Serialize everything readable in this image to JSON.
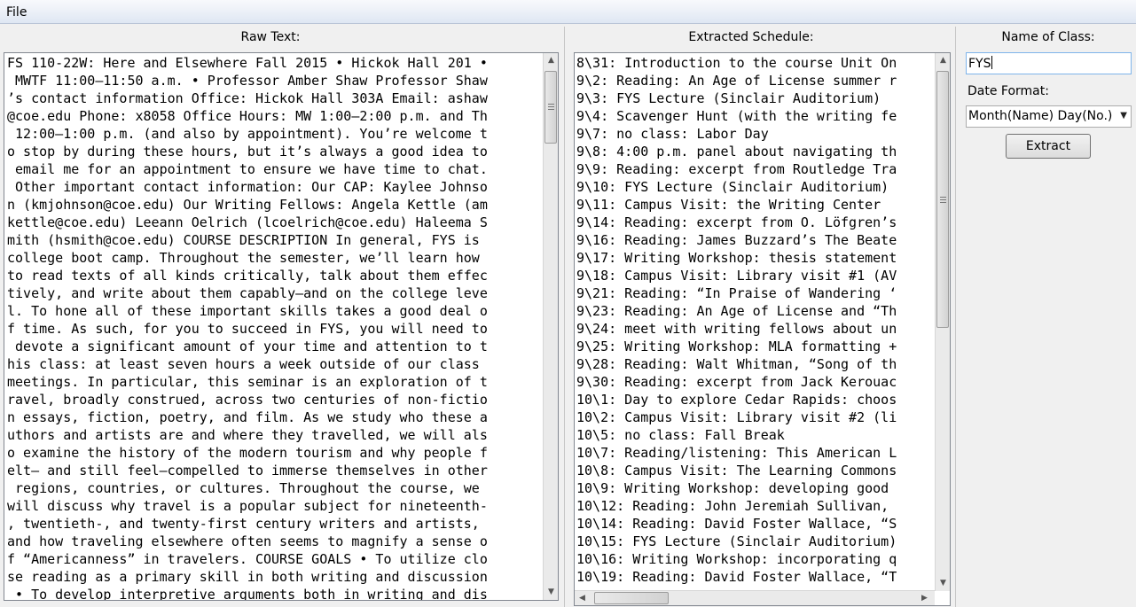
{
  "menu": {
    "file": "File"
  },
  "raw_panel": {
    "title": "Raw Text:",
    "lines": [
      "FS 110-22W: Here and Elsewhere Fall 2015 • Hickok Hall 201 •",
      " MWTF 11:00–11:50 a.m. • Professor Amber Shaw Professor Shaw",
      "’s contact information Office: Hickok Hall 303A Email: ashaw",
      "@coe.edu Phone: x8058 Office Hours: MW 1:00–2:00 p.m. and Th",
      " 12:00–1:00 p.m. (and also by appointment). You’re welcome t",
      "o stop by during these hours, but it’s always a good idea to",
      " email me for an appointment to ensure we have time to chat.",
      " Other important contact information: Our CAP: Kaylee Johnso",
      "n (kmjohnson@coe.edu) Our Writing Fellows: Angela Kettle (am",
      "kettle@coe.edu) Leeann Oelrich (lcoelrich@coe.edu) Haleema S",
      "mith (hsmith@coe.edu) COURSE DESCRIPTION In general, FYS is",
      "college boot camp. Throughout the semester, we’ll learn how",
      "to read texts of all kinds critically, talk about them effec",
      "tively, and write about them capably—and on the college leve",
      "l. To hone all of these important skills takes a good deal o",
      "f time. As such, for you to succeed in FYS, you will need to",
      " devote a significant amount of your time and attention to t",
      "his class: at least seven hours a week outside of our class",
      "meetings. In particular, this seminar is an exploration of t",
      "ravel, broadly construed, across two centuries of non-fictio",
      "n essays, fiction, poetry, and film. As we study who these a",
      "uthors and artists are and where they travelled, we will als",
      "o examine the history of the modern tourism and why people f",
      "elt— and still feel—compelled to immerse themselves in other",
      " regions, countries, or cultures. Throughout the course, we",
      "will discuss why travel is a popular subject for nineteenth-",
      ", twentieth-, and twenty-first century writers and artists,",
      "and how traveling elsewhere often seems to magnify a sense o",
      "f “Americanness” in travelers. COURSE GOALS • To utilize clo",
      "se reading as a primary skill in both writing and discussion",
      " • To develop interpretive arguments both in writing and dis"
    ]
  },
  "schedule_panel": {
    "title": "Extracted Schedule:",
    "lines": [
      "8\\31: Introduction to the course Unit On",
      "9\\2: Reading: An Age of License summer r",
      "9\\3: FYS Lecture (Sinclair Auditorium)",
      "9\\4: Scavenger Hunt (with the writing fe",
      "9\\7: no class: Labor Day",
      "9\\8: 4:00 p.m. panel about navigating th",
      "9\\9: Reading: excerpt from Routledge Tra",
      "9\\10: FYS Lecture (Sinclair Auditorium)",
      "9\\11: Campus Visit: the Writing Center",
      "9\\14: Reading: excerpt from O. Löfgren’s",
      "9\\16: Reading: James Buzzard’s The Beate",
      "9\\17: Writing Workshop: thesis statement",
      "9\\18: Campus Visit: Library visit #1 (AV",
      "9\\21: Reading: “In Praise of Wandering ‘",
      "9\\23: Reading: An Age of License and “Th",
      "9\\24: meet with writing fellows about un",
      "9\\25: Writing Workshop: MLA formatting +",
      "9\\28: Reading: Walt Whitman, “Song of th",
      "9\\30: Reading: excerpt from Jack Kerouac",
      "10\\1: Day to explore Cedar Rapids: choos",
      "10\\2: Campus Visit: Library visit #2 (li",
      "10\\5: no class: Fall Break",
      "10\\7: Reading/listening: This American L",
      "10\\8: Campus Visit: The Learning Commons",
      "10\\9: Writing Workshop: developing good",
      "10\\12: Reading: John Jeremiah Sullivan,",
      "10\\14: Reading: David Foster Wallace, “S",
      "10\\15: FYS Lecture (Sinclair Auditorium)",
      "10\\16: Writing Workshop: incorporating q",
      "10\\19: Reading: David Foster Wallace, “T"
    ]
  },
  "side_panel": {
    "class_name_label": "Name of Class:",
    "class_name_value": "FYS",
    "date_format_label": "Date Format:",
    "date_format_value": "Month(Name) Day(No.)",
    "extract_button": "Extract"
  }
}
